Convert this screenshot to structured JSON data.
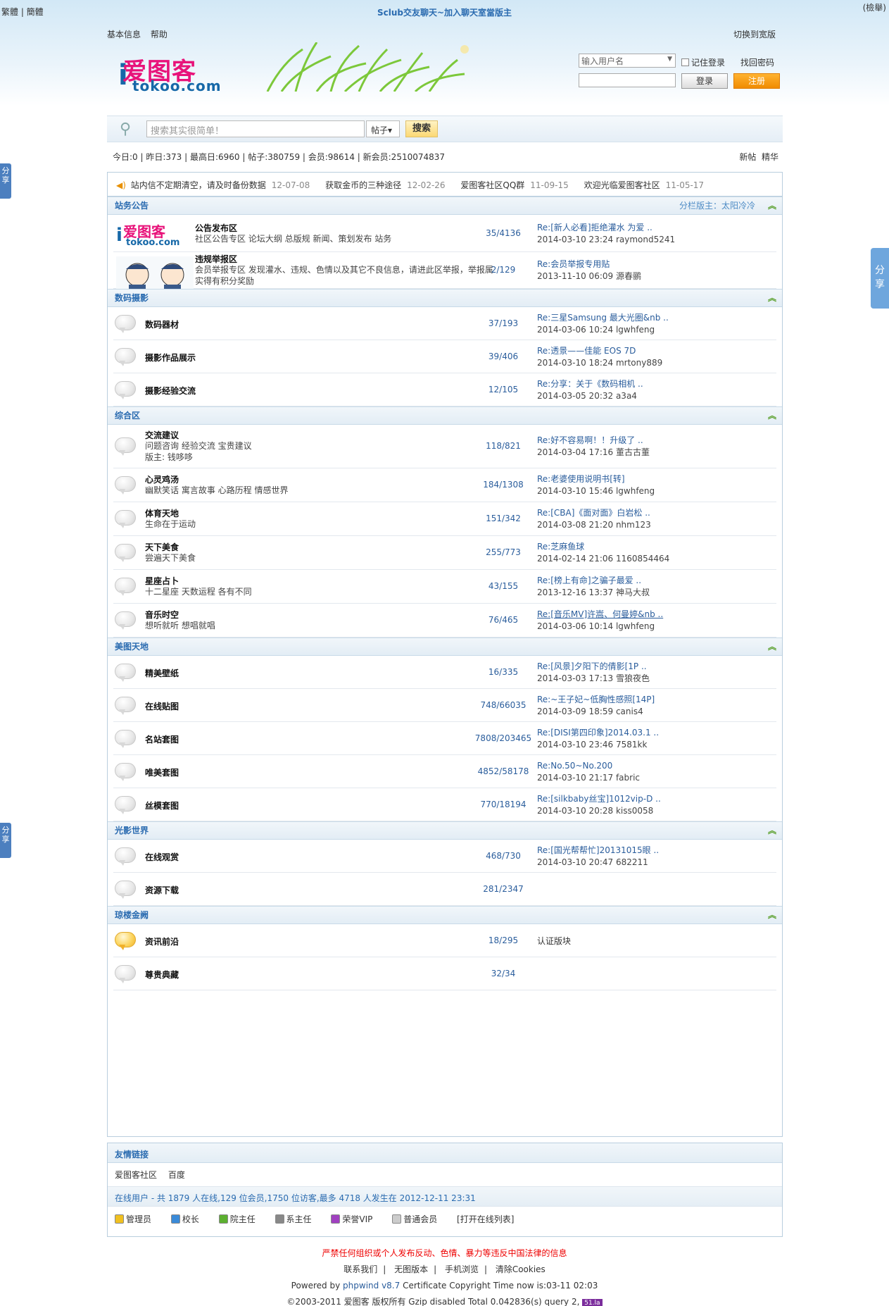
{
  "top": {
    "lang": "繁體 | 簡體",
    "center": "Sclub交友聊天~加入聊天室當版主",
    "right": "(檢舉)"
  },
  "subnav": {
    "items": [
      "基本信息",
      "帮助"
    ],
    "right": "切换到宽版"
  },
  "logo": {
    "cn": "爱图客",
    "url": "tokoo.com",
    "i": "i"
  },
  "login": {
    "user_placeholder": "输入用户名",
    "remember": "记住登录",
    "forgot": "找回密码",
    "login_btn": "登录",
    "register_btn": "注册"
  },
  "search": {
    "placeholder": "搜索其实很简单！",
    "type": "帖子",
    "button": "搜索"
  },
  "stats": {
    "text": "今日:0 | 昨日:373 | 最高日:6960 | 帖子:380759 | 会员:98614 | 新会员:2510074837",
    "new_posts": "新帖",
    "digest": "精华"
  },
  "notices": [
    {
      "t": "站内信不定期清空，请及时备份数据",
      "d": "12-07-08"
    },
    {
      "t": "获取金币的三种途径",
      "d": "12-02-26"
    },
    {
      "t": "爱图客社区QQ群",
      "d": "11-09-15"
    },
    {
      "t": "欢迎光临爱图客社区",
      "d": "11-05-17"
    }
  ],
  "categories": [
    {
      "name": "站务公告",
      "mod": "分栏版主：太阳冷冷",
      "forums": [
        {
          "name": "公告发布区",
          "desc": [
            "社区公告专区 论坛大纲 总版规 新闻、策划发布 站务"
          ],
          "count": "35/4136",
          "lt": "Re:[新人必看]拒绝灌水 为爱 ..",
          "lm": "2014-03-10 23:24 raymond5241"
        },
        {
          "name": "违规举报区",
          "desc": [
            "会员举报专区 发现灌水、违规、色情以及其它不良信息，请进此区举报，举报属",
            "实得有积分奖励"
          ],
          "count": "2/129",
          "lt": "Re:会员举报专用贴",
          "lm": "2013-11-10 06:09 源春鹂"
        }
      ]
    },
    {
      "name": "数码摄影",
      "mod": "",
      "forums": [
        {
          "name": "数码器材",
          "desc": [],
          "count": "37/193",
          "lt": "Re:三星Samsung 最大光圈&nb ..",
          "lm": "2014-03-06 10:24 lgwhfeng"
        },
        {
          "name": "摄影作品展示",
          "desc": [],
          "count": "39/406",
          "lt": "Re:透景——佳能 EOS 7D",
          "lm": "2014-03-10 18:24 mrtony889"
        },
        {
          "name": "摄影经验交流",
          "desc": [],
          "count": "12/105",
          "lt": "Re:分享：关于《数码相机 ..",
          "lm": "2014-03-05 20:32 a3a4"
        }
      ]
    },
    {
      "name": "综合区",
      "mod": "",
      "forums": [
        {
          "name": "交流建议",
          "desc": [
            "问题咨询 经验交流 宝贵建议",
            "版主: 钱哆哆"
          ],
          "count": "118/821",
          "lt": "Re:好不容易啊！！升级了 ..",
          "lm": "2014-03-04 17:16 董古古董"
        },
        {
          "name": "心灵鸡汤",
          "desc": [
            "幽默笑话 寓言故事 心路历程 情感世界"
          ],
          "count": "184/1308",
          "lt": "Re:老婆使用说明书[转]",
          "lm": "2014-03-10 15:46 lgwhfeng"
        },
        {
          "name": "体育天地",
          "desc": [
            "生命在于运动"
          ],
          "count": "151/342",
          "lt": "Re:[CBA]《面对面》白岩松 ..",
          "lm": "2014-03-08 21:20 nhm123"
        },
        {
          "name": "天下美食",
          "desc": [
            "尝遍天下美食"
          ],
          "count": "255/773",
          "lt": "Re:芝麻鱼球",
          "lm": "2014-02-14 21:06 1160854464"
        },
        {
          "name": "星座占卜",
          "desc": [
            "十二星座 天数运程 各有不同"
          ],
          "count": "43/155",
          "lt": "Re:[榜上有命]之骗子最爱 ..",
          "lm": "2013-12-16 13:37 神马大叔"
        },
        {
          "name": "音乐时空",
          "desc": [
            "想听就听 想唱就唱"
          ],
          "count": "76/465",
          "lt": "Re:[音乐MV]许嵩、何曼婷&nb ..",
          "lm": "2014-03-06 10:14 lgwhfeng",
          "u": true
        }
      ]
    },
    {
      "name": "美图天地",
      "mod": "",
      "forums": [
        {
          "name": "精美壁纸",
          "desc": [],
          "count": "16/335",
          "lt": "Re:[风景]夕阳下的倩影[1P ..",
          "lm": "2014-03-03 17:13 雪狼夜色"
        },
        {
          "name": "在线贴图",
          "desc": [],
          "count": "748/66035",
          "lt": "Re:~王子妃~低胸性感照[14P]",
          "lm": "2014-03-09 18:59 canis4"
        },
        {
          "name": "名站套图",
          "desc": [],
          "count": "7808/203465",
          "lt": "Re:[DISI第四印象]2014.03.1 ..",
          "lm": "2014-03-10 23:46 7581kk"
        },
        {
          "name": "唯美套图",
          "desc": [],
          "count": "4852/58178",
          "lt": "Re:No.50~No.200",
          "lm": "2014-03-10 21:17 fabric"
        },
        {
          "name": "丝模套图",
          "desc": [],
          "count": "770/18194",
          "lt": "Re:[silkbaby丝宝]1012vip-D ..",
          "lm": "2014-03-10 20:28 kiss0058"
        }
      ]
    },
    {
      "name": "光影世界",
      "mod": "",
      "forums": [
        {
          "name": "在线观赏",
          "desc": [],
          "count": "468/730",
          "lt": "Re:[国光帮帮忙]20131015眼 ..",
          "lm": "2014-03-10 20:47 682211"
        },
        {
          "name": "资源下载",
          "desc": [],
          "count": "281/2347",
          "lt": "",
          "lm": ""
        }
      ]
    },
    {
      "name": "琼楼金阙",
      "mod": "",
      "forums": [
        {
          "name": "资讯前沿",
          "desc": [],
          "count": "18/295",
          "lt": "",
          "lm": "",
          "plain": "认证版块",
          "gold": true
        },
        {
          "name": "尊贵典藏",
          "desc": [],
          "count": "32/34",
          "lt": "",
          "lm": ""
        }
      ]
    }
  ],
  "friend": {
    "title": "友情链接",
    "links": [
      "爱图客社区",
      "百度"
    ],
    "online": "在线用户 - 共 1879 人在线,129 位会员,1750 位访客,最多 4718 人发生在 2012-12-11 23:31",
    "roles": [
      {
        "n": "管理员",
        "c": "#f0c020"
      },
      {
        "n": "校长",
        "c": "#3a8ad8"
      },
      {
        "n": "院主任",
        "c": "#5cb030"
      },
      {
        "n": "系主任",
        "c": "#888"
      },
      {
        "n": "荣誉VIP",
        "c": "#a040c0"
      },
      {
        "n": "普通会员",
        "c": "#ccc"
      }
    ],
    "open": "[打开在线列表]"
  },
  "footer": {
    "warn": "严禁任何组织或个人发布反动、色情、暴力等违反中国法律的信息",
    "nav": [
      "联系我们",
      "无图版本",
      "手机浏览",
      "清除Cookies"
    ],
    "powered": "Powered by",
    "pw": "phpwind v8.7",
    "cert": "Certificate Copyright Time now is:03-11 02:03",
    "copy": "©2003-2011 爱图客 版权所有 Gzip disabled Total 0.042836(s) query 2,",
    "badge": "51.la"
  },
  "share": {
    "label": "分享"
  }
}
